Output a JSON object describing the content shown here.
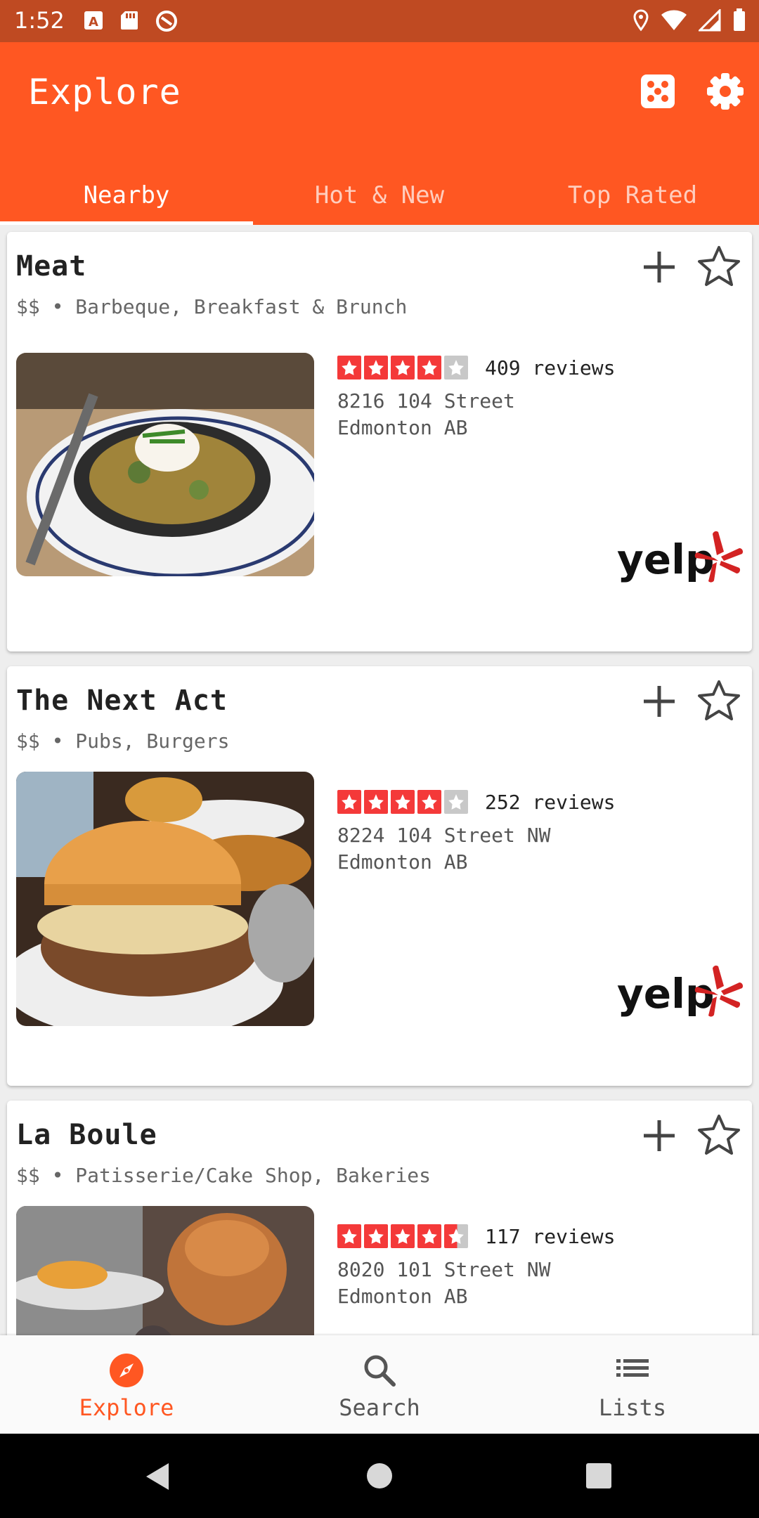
{
  "status_bar": {
    "time": "1:52"
  },
  "app_bar": {
    "title": "Explore"
  },
  "tabs": [
    {
      "label": "Nearby",
      "active": true
    },
    {
      "label": "Hot & New",
      "active": false
    },
    {
      "label": "Top Rated",
      "active": false
    }
  ],
  "restaurants": [
    {
      "name": "Meat",
      "meta": "$$ • Barbeque, Breakfast & Brunch",
      "rating": 4,
      "reviews": "409 reviews",
      "address_line1": "8216 104 Street",
      "address_line2": "Edmonton AB"
    },
    {
      "name": "The Next Act",
      "meta": "$$ • Pubs, Burgers",
      "rating": 4,
      "reviews": "252 reviews",
      "address_line1": "8224 104 Street NW",
      "address_line2": "Edmonton AB"
    },
    {
      "name": "La Boule",
      "meta": "$$ • Patisserie/Cake Shop, Bakeries",
      "rating": 4.5,
      "reviews": "117 reviews",
      "address_line1": "8020 101 Street NW",
      "address_line2": "Edmonton AB"
    }
  ],
  "bottom_nav": [
    {
      "label": "Explore",
      "icon": "compass-icon",
      "active": true
    },
    {
      "label": "Search",
      "icon": "search-icon",
      "active": false
    },
    {
      "label": "Lists",
      "icon": "list-icon",
      "active": false
    }
  ],
  "logo_text": "yelp",
  "colors": {
    "accent": "#ff5722",
    "status_bar": "#bf4a22",
    "star_on": "#f43939",
    "star_off": "#c8c8c8",
    "yelp_red": "#d32323"
  }
}
